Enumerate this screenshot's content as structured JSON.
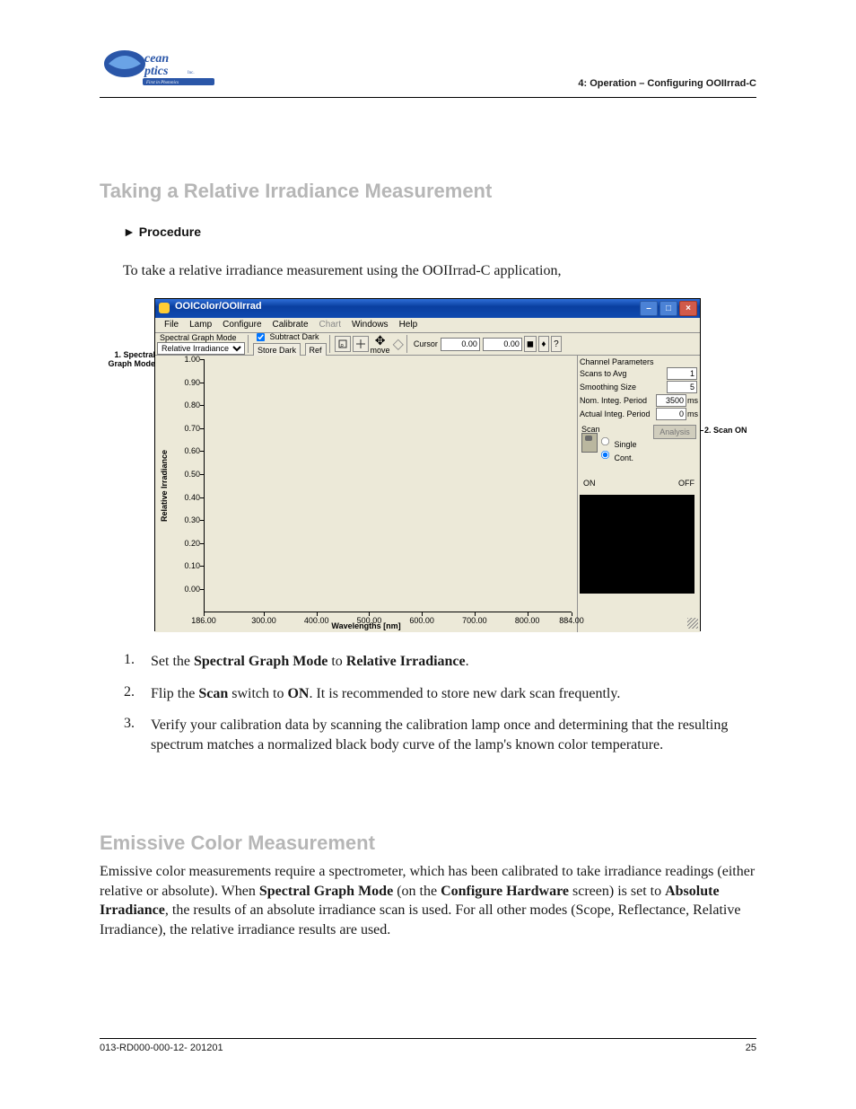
{
  "header_right": "4: Operation – Configuring OOIIrrad-C",
  "section1_title": "Taking a Relative Irradiance Measurement",
  "procedure_label": "Procedure",
  "intro": "To take a relative irradiance measurement using the OOIIrrad-C application,",
  "callouts": {
    "left": "1. Spectral\nGraph Mode",
    "right": "2. Scan ON"
  },
  "window": {
    "title": "OOIColor/OOIIrrad",
    "menu": [
      "File",
      "Lamp",
      "Configure",
      "Calibrate",
      "Chart",
      "Windows",
      "Help"
    ],
    "menu_disabled_index": 4,
    "toolbar": {
      "group_label": "Spectral Graph Mode",
      "select_value": "Relative Irradiance",
      "subtract": "Subtract Dark",
      "store_dark": "Store Dark",
      "ref": "Ref",
      "move": "move",
      "cursor": "Cursor",
      "c1": "0.00",
      "c2": "0.00"
    },
    "side": {
      "header": "Channel Parameters",
      "rows": [
        {
          "l": "Scans to Avg",
          "v": "1",
          "u": ""
        },
        {
          "l": "Smoothing Size",
          "v": "5",
          "u": ""
        },
        {
          "l": "Nom. Integ. Period",
          "v": "3500",
          "u": "ms"
        },
        {
          "l": "Actual Integ. Period",
          "v": "0",
          "u": "ms"
        }
      ],
      "scan": "Scan",
      "analysis": "Analysis",
      "single": "Single",
      "cont": "Cont.",
      "on": "ON",
      "off": "OFF"
    }
  },
  "chart_data": {
    "type": "line",
    "title": "",
    "xlabel": "Wavelengths [nm]",
    "ylabel": "Relative Irradiance",
    "yticks": [
      "0.00",
      "0.10",
      "0.20",
      "0.30",
      "0.40",
      "0.50",
      "0.60",
      "0.70",
      "0.80",
      "0.90",
      "1.00"
    ],
    "xticks": [
      "186.00",
      "300.00",
      "400.00",
      "500.00",
      "600.00",
      "700.00",
      "800.00",
      "884.00"
    ],
    "xlim": [
      186,
      884
    ],
    "ylim": [
      0,
      1
    ],
    "series": []
  },
  "steps": [
    {
      "n": "1.",
      "pre": "Set the ",
      "b1": "Spectral Graph Mode",
      "mid": " to ",
      "b2": "Relative Irradiance",
      "post": "."
    },
    {
      "n": "2.",
      "pre": "Flip the ",
      "b1": "Scan",
      "mid": " switch to ",
      "b2": "ON",
      "post": ". It is recommended to store new dark scan frequently."
    },
    {
      "n": "3.",
      "text": "Verify your calibration data by scanning the calibration lamp once and determining that the resulting spectrum matches a normalized black body curve of the lamp's known color temperature."
    }
  ],
  "section2_title": "Emissive Color Measurement",
  "para": {
    "a": "Emissive color measurements require a spectrometer, which has been calibrated to take irradiance readings (either relative or absolute). When ",
    "b": "Spectral Graph Mode",
    "c": " (on the ",
    "d": "Configure Hardware",
    "e": " screen) is set to ",
    "f": "Absolute Irradiance",
    "g": ", the results of an absolute irradiance scan is used. For all other modes (Scope, Reflectance, Relative Irradiance), the relative irradiance results are used."
  },
  "footer": {
    "left": "013-RD000-000-12- 201201",
    "right": "25"
  }
}
